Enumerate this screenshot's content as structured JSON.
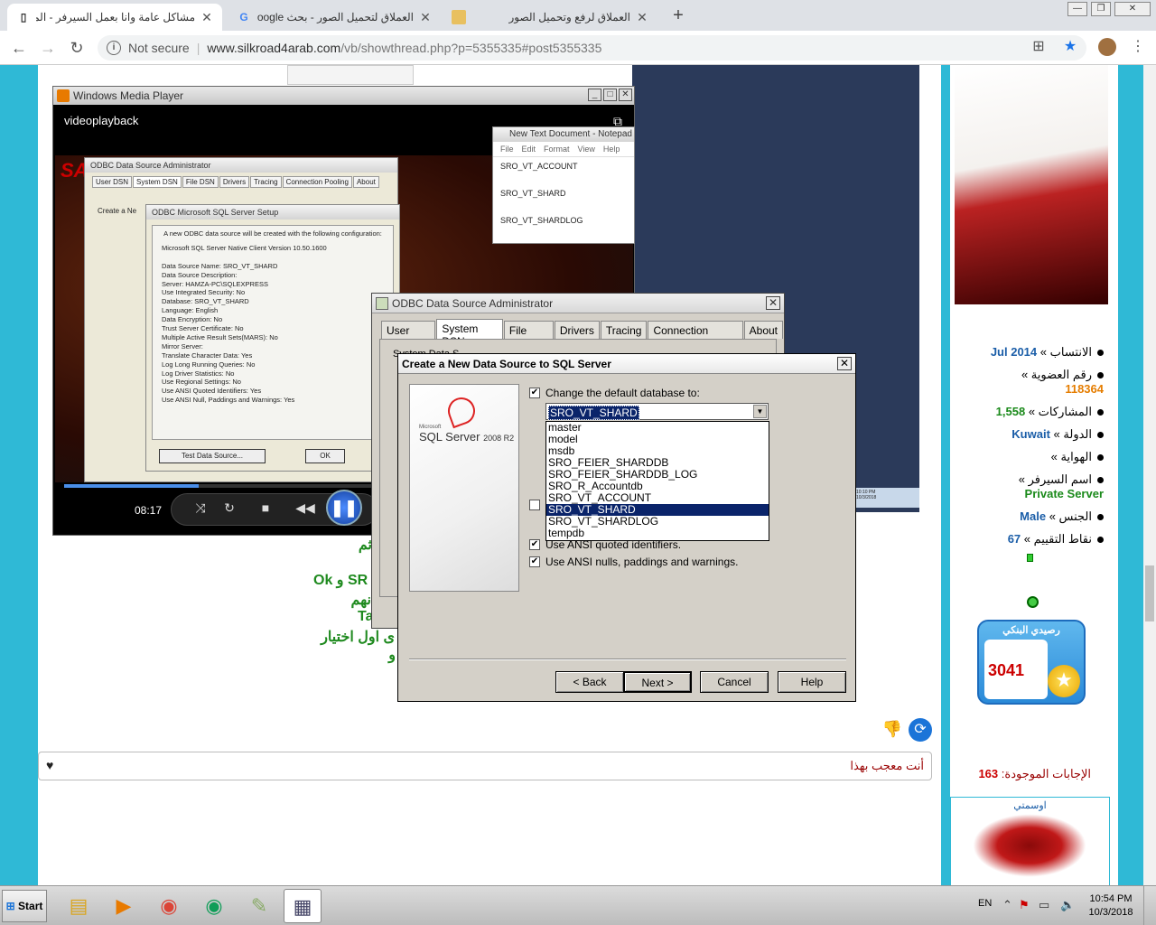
{
  "browser": {
    "tabs": [
      {
        "title": "مشاكل عامة وانا بعمل السيرفر - الموقع",
        "icon": "page-icon",
        "active": true
      },
      {
        "title": "العملاق لتحميل الصور - بحث Google",
        "icon": "google-icon",
        "active": false
      },
      {
        "title": "العملاق لرفع وتحميل الصور",
        "icon": "image-site-icon",
        "active": false
      }
    ],
    "address": {
      "security": "Not secure",
      "host": "www.silkroad4arab.com",
      "path": "/vb/showthread.php?p=5355335#post5355335"
    }
  },
  "wmp": {
    "window_title": "Windows Media Player",
    "video_title": "videoplayback",
    "time": "08:17",
    "progress": 0.24
  },
  "video_content": {
    "admin_title": "ODBC Data Source Administrator",
    "admin_tabs": [
      "User DSN",
      "System DSN",
      "File DSN",
      "Drivers",
      "Tracing",
      "Connection Pooling",
      "About"
    ],
    "setup_title": "ODBC Microsoft SQL Server Setup",
    "setup_intro": "A new ODBC data source will be created with the following configuration:",
    "setup_lines": [
      "Microsoft SQL Server Native Client Version 10.50.1600",
      "",
      "Data Source Name: SRO_VT_SHARD",
      "Data Source Description:",
      "Server: HAMZA-PC\\SQLEXPRESS",
      "Use Integrated Security: No",
      "Database: SRO_VT_SHARD",
      "Language: English",
      "Data Encryption: No",
      "Trust Server Certificate: No",
      "Multiple Active Result Sets(MARS): No",
      "Mirror Server:",
      "Translate Character Data: Yes",
      "Log Long Running Queries: No",
      "Log Driver Statistics: No",
      "Use Regional Settings: No",
      "Use ANSI Quoted Identifiers: Yes",
      "Use ANSI Null, Paddings and Warnings: Yes"
    ],
    "test_button": "Test Data Source...",
    "ok_button": "OK",
    "create_new": "Create a Ne",
    "notepad_title": "New Text Document - Notepad",
    "notepad_menu": [
      "File",
      "Edit",
      "Format",
      "View",
      "Help"
    ],
    "notepad_lines": [
      "SRO_VT_ACCOUNT",
      "SRO_VT_SHARD",
      "SRO_VT_SHARDLOG"
    ],
    "tray_time": "10:10 PM",
    "tray_date": "10/3/2018"
  },
  "odbc": {
    "title": "ODBC Data Source Administrator",
    "tabs": [
      "User DSN",
      "System DSN",
      "File DSN",
      "Drivers",
      "Tracing",
      "Connection Pooling",
      "About"
    ],
    "active_tab": "System DSN",
    "partial_text": "System Data S"
  },
  "create_ds": {
    "title": "Create a New Data Source to SQL Server",
    "logo_vendor": "Microsoft",
    "logo_product": "SQL Server",
    "logo_version": "2008 R2",
    "change_db_label": "Change the default database to:",
    "change_db_checked": true,
    "selected_db": "SRO_VT_SHARD",
    "db_options": [
      "master",
      "model",
      "msdb",
      "SRO_FEIER_SHARDDB",
      "SRO_FEIER_SHARDDB_LOG",
      "SRO_R_Accountdb",
      "SRO_VT_ACCOUNT",
      "SRO_VT_SHARD",
      "SRO_VT_SHARDLOG",
      "tempdb"
    ],
    "ansi_quoted_label": "Use ANSI quoted identifiers.",
    "ansi_nulls_label": "Use ANSI nulls, paddings and warnings.",
    "buttons": {
      "back": "< Back",
      "next": "Next >",
      "cancel": "Cancel",
      "help": "Help"
    }
  },
  "post": {
    "lines": [
      "ثم",
      "Ok و SR",
      "نهم",
      "Ta",
      "ى اول اختيار",
      "و"
    ],
    "like_text": "أنت معجب بهذا"
  },
  "sidebar": {
    "fields": [
      {
        "label": "الانتساب »",
        "value": "Jul 2014",
        "color": "blue"
      },
      {
        "label": "رقم العضوية »",
        "value": "118364",
        "color": "orange"
      },
      {
        "label": "المشاركات »",
        "value": "1,558",
        "color": "green"
      },
      {
        "label": "الدولة »",
        "value": "Kuwait",
        "color": "blue"
      },
      {
        "label": "الهواية »",
        "value": "",
        "color": "blue"
      },
      {
        "label": "اسم السيرفر »",
        "value": "Private Server",
        "color": "green"
      },
      {
        "label": "الجنس »",
        "value": "Male",
        "color": "blue"
      },
      {
        "label": "نقاط التقييم »",
        "value": "67",
        "color": "blue"
      }
    ],
    "bank_title": "رصيدي البنكي",
    "bank_value": "3041",
    "replies_label": "الإجابات الموجودة:",
    "replies_count": "163",
    "medal_header": "اوسمتي"
  },
  "taskbar": {
    "start": "Start",
    "lang": "EN",
    "time": "10:54 PM",
    "date": "10/3/2018"
  },
  "colors": {
    "page_bg": "#2fb9d6",
    "selection": "#0a246a",
    "accent_green": "#1f8a1f"
  }
}
